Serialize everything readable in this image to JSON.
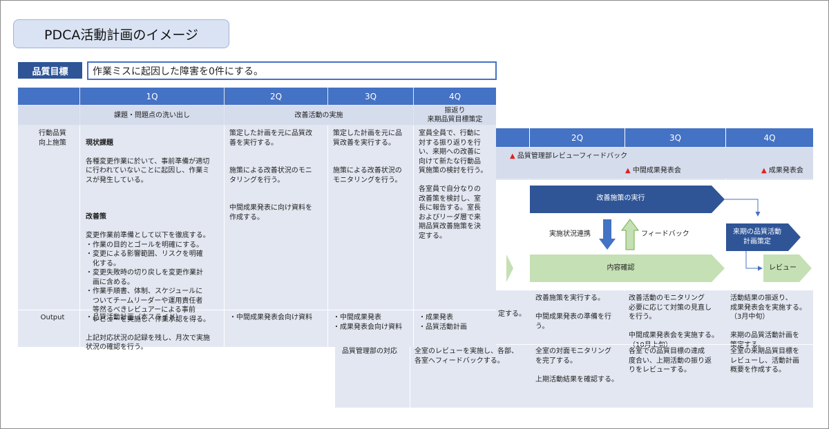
{
  "title": "PDCA活動計画のイメージ",
  "goal": {
    "label": "品質目標",
    "value": "作業ミスに起因した障害を0件にする。"
  },
  "back_table": {
    "quarters": [
      "2Q",
      "3Q",
      "4Q"
    ],
    "milestones": {
      "review_feedback": "品質管理部レビューフィードバック",
      "mid_report": "中間成果発表会",
      "result_report": "成果発表会",
      "marker": "▲"
    },
    "flow": {
      "implement": "改善施策の実行",
      "status_link": "実施状況連携",
      "feedback": "フィードバック",
      "confirm": "内容確認",
      "next_plan": "来期の品質活動\n計画策定",
      "review": "レビュー"
    },
    "action_rows": {
      "col1_fragment": "定する。",
      "q2": "改善施策を実行する。\n\n中間成果発表の準備を行う。",
      "q3": "改善活動のモニタリング\n必要に応じて対策の見直し\nを行う。\n\n中間成果発表会を実施する。\n（10月上旬）",
      "q4": "活動結果の振返り、\n成果発表会を実施する。\n（3月中旬）\n\n来期の品質活動計画を\n策定する。"
    },
    "qm_row": {
      "label": "品質管理部の対応",
      "q1": "全室のレビューを実施し、各部、\n各室へフィードバックする。",
      "q2": "全室の対面モニタリング\nを完了する。\n\n上期活動結果を確認する。",
      "q3": "各室での品質目標の達成\n度合い、上期活動の振り返\nりをレビューする。",
      "q4": "全室の来期品質目標を\nレビューし、活動計画\n概要を作成する。"
    }
  },
  "front_table": {
    "quarters": [
      "1Q",
      "2Q",
      "3Q",
      "4Q"
    ],
    "phases": {
      "q1": "課題・問題点の洗い出し",
      "q23": "改善活動の実施",
      "q4": "振返り\n来期品質目標策定"
    },
    "row1_label": "行動品質\n向上施策",
    "q1_heading1": "現状課題",
    "q1_text1": "各種変更作業に於いて、事前準備が適切\nに行われていないことに起因し、作業ミ\nスが発生している。",
    "q1_heading2": "改善策",
    "q1_text2": "変更作業前準備として以下を徹底する。\n・作業の目的とゴールを明確にする。\n・変更による影響範囲、リスクを明確\n　化する。\n・変更失敗時の切り戻しを変更作業計\n　画に含める。\n・作業手順書、体制、スケジュールに\n　ついてチームリーダーや運用責任者\n　等然るべきレビュアーによる事前\n　レビューを実施し、作業承認を得る。\n\n上記対応状況の記録を残し、月次で実施\n状況の確認を行う。",
    "q2_text": "策定した計画を元に品質改\n善を実行する。\n\n\n施策による改善状況のモニ\nタリングを行う。\n\n\n中間成果発表に向け資料を\n作成する。",
    "q3_text": "策定した計画を元に品\n質改善を実行する。\n\n\n施策による改善状況の\nモニタリングを行う。",
    "q4_text": "室員全員で、行動に\n対する振り返りを行\nい、来期への改善に\n向けて新たな行動品\n質施策の検討を行う。\n\n各室員で自分なりの\n改善策を検討し、室\n長に報告する。室長\nおよびリーダ層で来\n期品質改善施策を決\n定する。",
    "output_label": "Output",
    "out_q1": "・品質活動計画（本スライド）",
    "out_q2": "・中間成果発表会向け資料",
    "out_q3": "・中間成果発表\n・成果発表会向け資料",
    "out_q4": "・成果発表\n・品質活動計画"
  },
  "colors": {
    "header_blue": "#4472c4",
    "dark_blue": "#2f5597",
    "light_blue": "#dae3f3",
    "row_bg": "#e2e7f1",
    "green": "#c5e0b4",
    "red": "#e02020"
  }
}
